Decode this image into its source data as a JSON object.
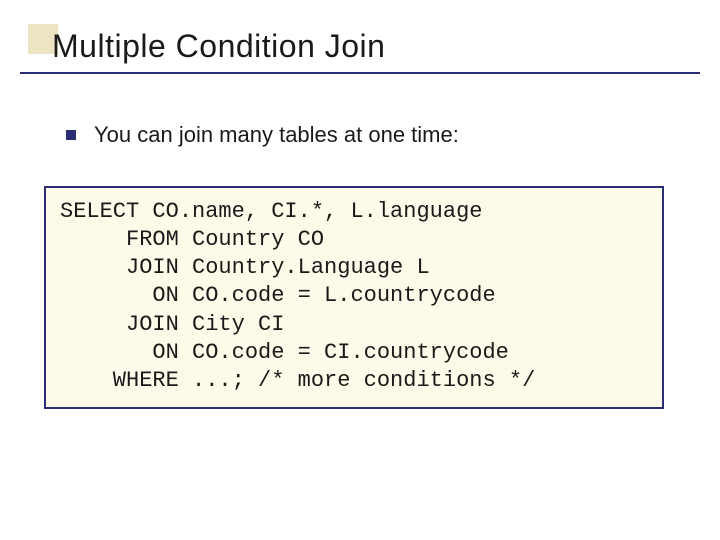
{
  "title": "Multiple Condition Join",
  "bullet": "You can join many tables at one time:",
  "code": {
    "l1": "SELECT CO.name, CI.*, L.language",
    "l2": "     FROM Country CO",
    "l3": "     JOIN Country.Language L",
    "l4": "       ON CO.code = L.countrycode",
    "l5": "     JOIN City CI",
    "l6": "       ON CO.code = CI.countrycode",
    "l7": "    WHERE ...; /* more conditions */"
  }
}
